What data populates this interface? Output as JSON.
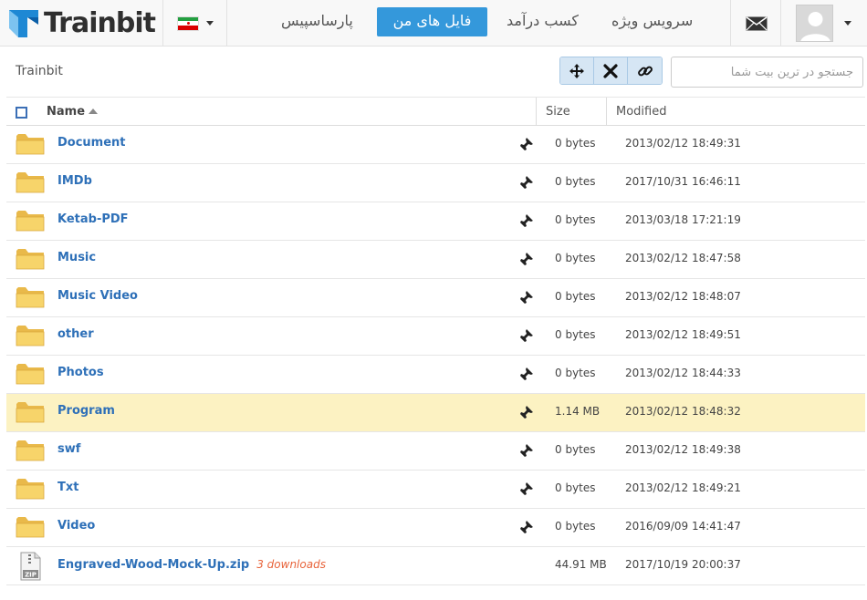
{
  "brand": {
    "name": "Trainbit"
  },
  "nav": {
    "menu": [
      {
        "label": "پارساسپیس",
        "active": false
      },
      {
        "label": "فایل های من",
        "active": true
      },
      {
        "label": "کسب درآمد",
        "active": false
      },
      {
        "label": "سرویس ویژه",
        "active": false
      }
    ],
    "language_flag": "iran-flag-icon",
    "mail_icon": "envelope-icon",
    "avatar_icon": "user-avatar-icon"
  },
  "toolbar": {
    "breadcrumb": "Trainbit",
    "buttons": [
      {
        "icon": "move-icon"
      },
      {
        "icon": "delete-icon"
      },
      {
        "icon": "link-icon"
      }
    ],
    "search_placeholder": "جستجو در ترین بیت شما"
  },
  "table": {
    "columns": {
      "name": "Name",
      "size": "Size",
      "modified": "Modified"
    },
    "sort": {
      "column": "Name",
      "direction": "asc"
    },
    "rows": [
      {
        "type": "folder",
        "name": "Document",
        "size": "0 bytes",
        "modified": "2013/02/12 18:49:31",
        "highlight": false
      },
      {
        "type": "folder",
        "name": "IMDb",
        "size": "0 bytes",
        "modified": "2017/10/31 16:46:11",
        "highlight": false
      },
      {
        "type": "folder",
        "name": "Ketab-PDF",
        "size": "0 bytes",
        "modified": "2013/03/18 17:21:19",
        "highlight": false
      },
      {
        "type": "folder",
        "name": "Music",
        "size": "0 bytes",
        "modified": "2013/02/12 18:47:58",
        "highlight": false
      },
      {
        "type": "folder",
        "name": "Music Video",
        "size": "0 bytes",
        "modified": "2013/02/12 18:48:07",
        "highlight": false
      },
      {
        "type": "folder",
        "name": "other",
        "size": "0 bytes",
        "modified": "2013/02/12 18:49:51",
        "highlight": false
      },
      {
        "type": "folder",
        "name": "Photos",
        "size": "0 bytes",
        "modified": "2013/02/12 18:44:33",
        "highlight": false
      },
      {
        "type": "folder",
        "name": "Program",
        "size": "1.14 MB",
        "modified": "2013/02/12 18:48:32",
        "highlight": true
      },
      {
        "type": "folder",
        "name": "swf",
        "size": "0 bytes",
        "modified": "2013/02/12 18:49:38",
        "highlight": false
      },
      {
        "type": "folder",
        "name": "Txt",
        "size": "0 bytes",
        "modified": "2013/02/12 18:49:21",
        "highlight": false
      },
      {
        "type": "folder",
        "name": "Video",
        "size": "0 bytes",
        "modified": "2016/09/09 14:41:47",
        "highlight": false
      },
      {
        "type": "zip",
        "name": "Engraved-Wood-Mock-Up.zip",
        "downloads": "3 downloads",
        "size": "44.91 MB",
        "modified": "2017/10/19 20:00:37",
        "highlight": false
      }
    ]
  },
  "colors": {
    "accent": "#3498db",
    "link": "#2e70b8",
    "highlight_row": "#fcf2c2",
    "downloads": "#e8633a",
    "folder": "#f7d46a"
  }
}
